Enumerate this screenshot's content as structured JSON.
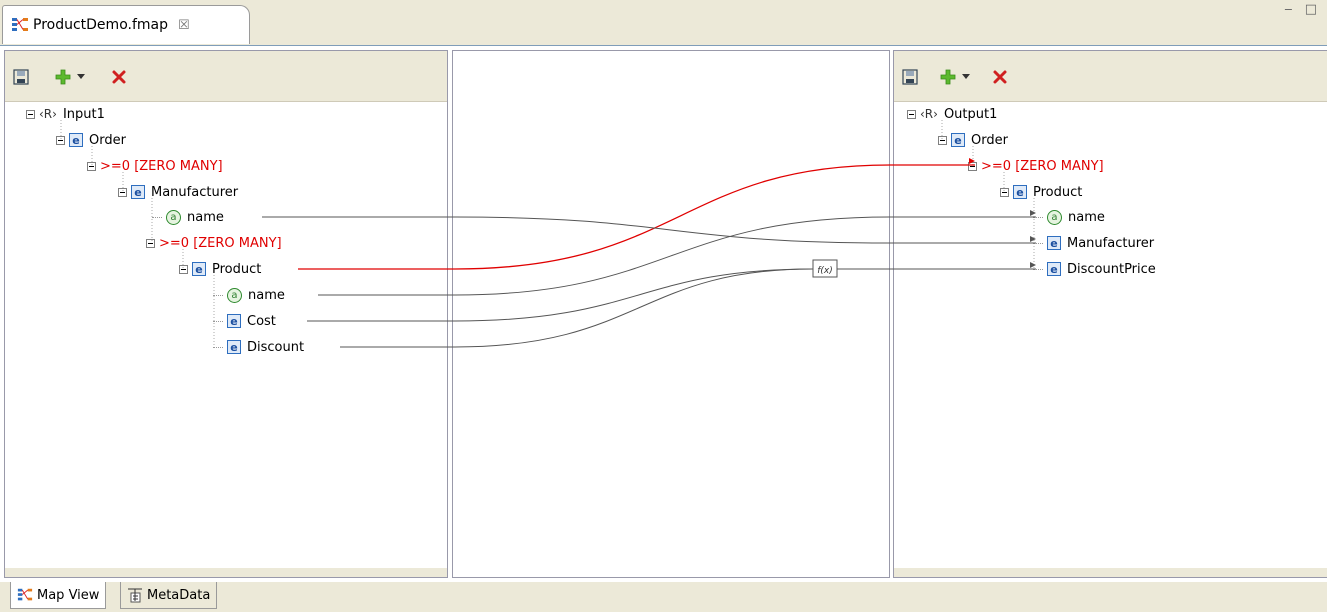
{
  "editor_tab": {
    "title": "ProductDemo.fmap",
    "close_glyph": "☒"
  },
  "window_controls": {
    "minimize": "‒",
    "maximize": "□"
  },
  "input_tree": {
    "root": "Input1",
    "order": "Order",
    "order_multi": ">=0 [ZERO MANY]",
    "manufacturer": "Manufacturer",
    "manufacturer_name": "name",
    "manufacturer_multi": ">=0 [ZERO MANY]",
    "product": "Product",
    "product_name": "name",
    "cost": "Cost",
    "discount": "Discount"
  },
  "output_tree": {
    "root": "Output1",
    "order": "Order",
    "order_multi": ">=0 [ZERO MANY]",
    "product": "Product",
    "name": "name",
    "manufacturer": "Manufacturer",
    "discount_price": "DiscountPrice"
  },
  "icons": {
    "root_glyph": "‹R›",
    "element_glyph": "e",
    "attribute_glyph": "a",
    "function_glyph": "f(x)"
  },
  "bottom_tabs": {
    "map_view": "Map View",
    "metadata": "MetaData"
  },
  "colors": {
    "mapping_red": "#e00000",
    "mapping_gray": "#555555",
    "element_blue": "#2e6ebf",
    "attribute_green": "#2f8a2f"
  }
}
